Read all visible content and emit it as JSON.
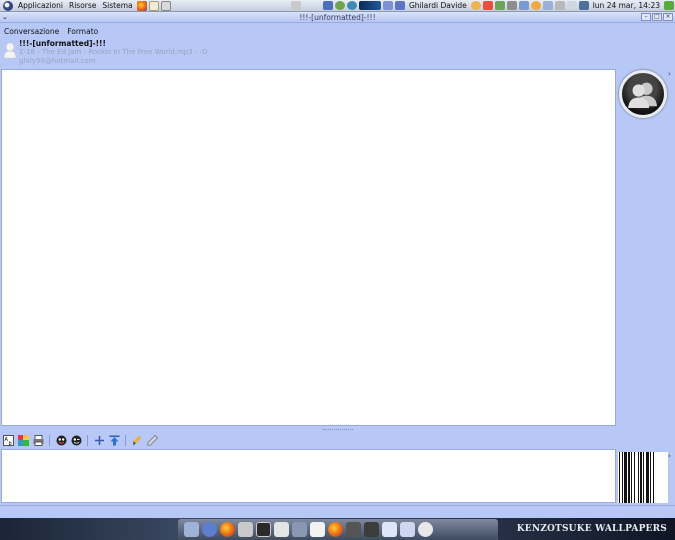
{
  "top_panel": {
    "menus": [
      "Applicazioni",
      "Risorse",
      "Sistema"
    ],
    "user_name": "Ghilardi Davide",
    "clock": "lun 24 mar, 14:23"
  },
  "window": {
    "title": "!!!-[unformatted]-!!!",
    "minimize_label": "–",
    "maximize_label": "□",
    "close_label": "×"
  },
  "menubar": {
    "items": [
      "Conversazione",
      "Formato"
    ]
  },
  "contact": {
    "name": "!!!-[unformatted]-!!!",
    "status": "Σ-18 - The Ed Jam - Rockin In The Free World.mp3 - :O",
    "email": "ghily90@hotmail.com"
  },
  "wallpaper": {
    "brand": "KENZOTSUKE WALLPAPERS"
  },
  "colors": {
    "window_bg": "#b7c8f7",
    "title_bar": "#c3d1f6",
    "conversation_bg": "#ffffff"
  }
}
